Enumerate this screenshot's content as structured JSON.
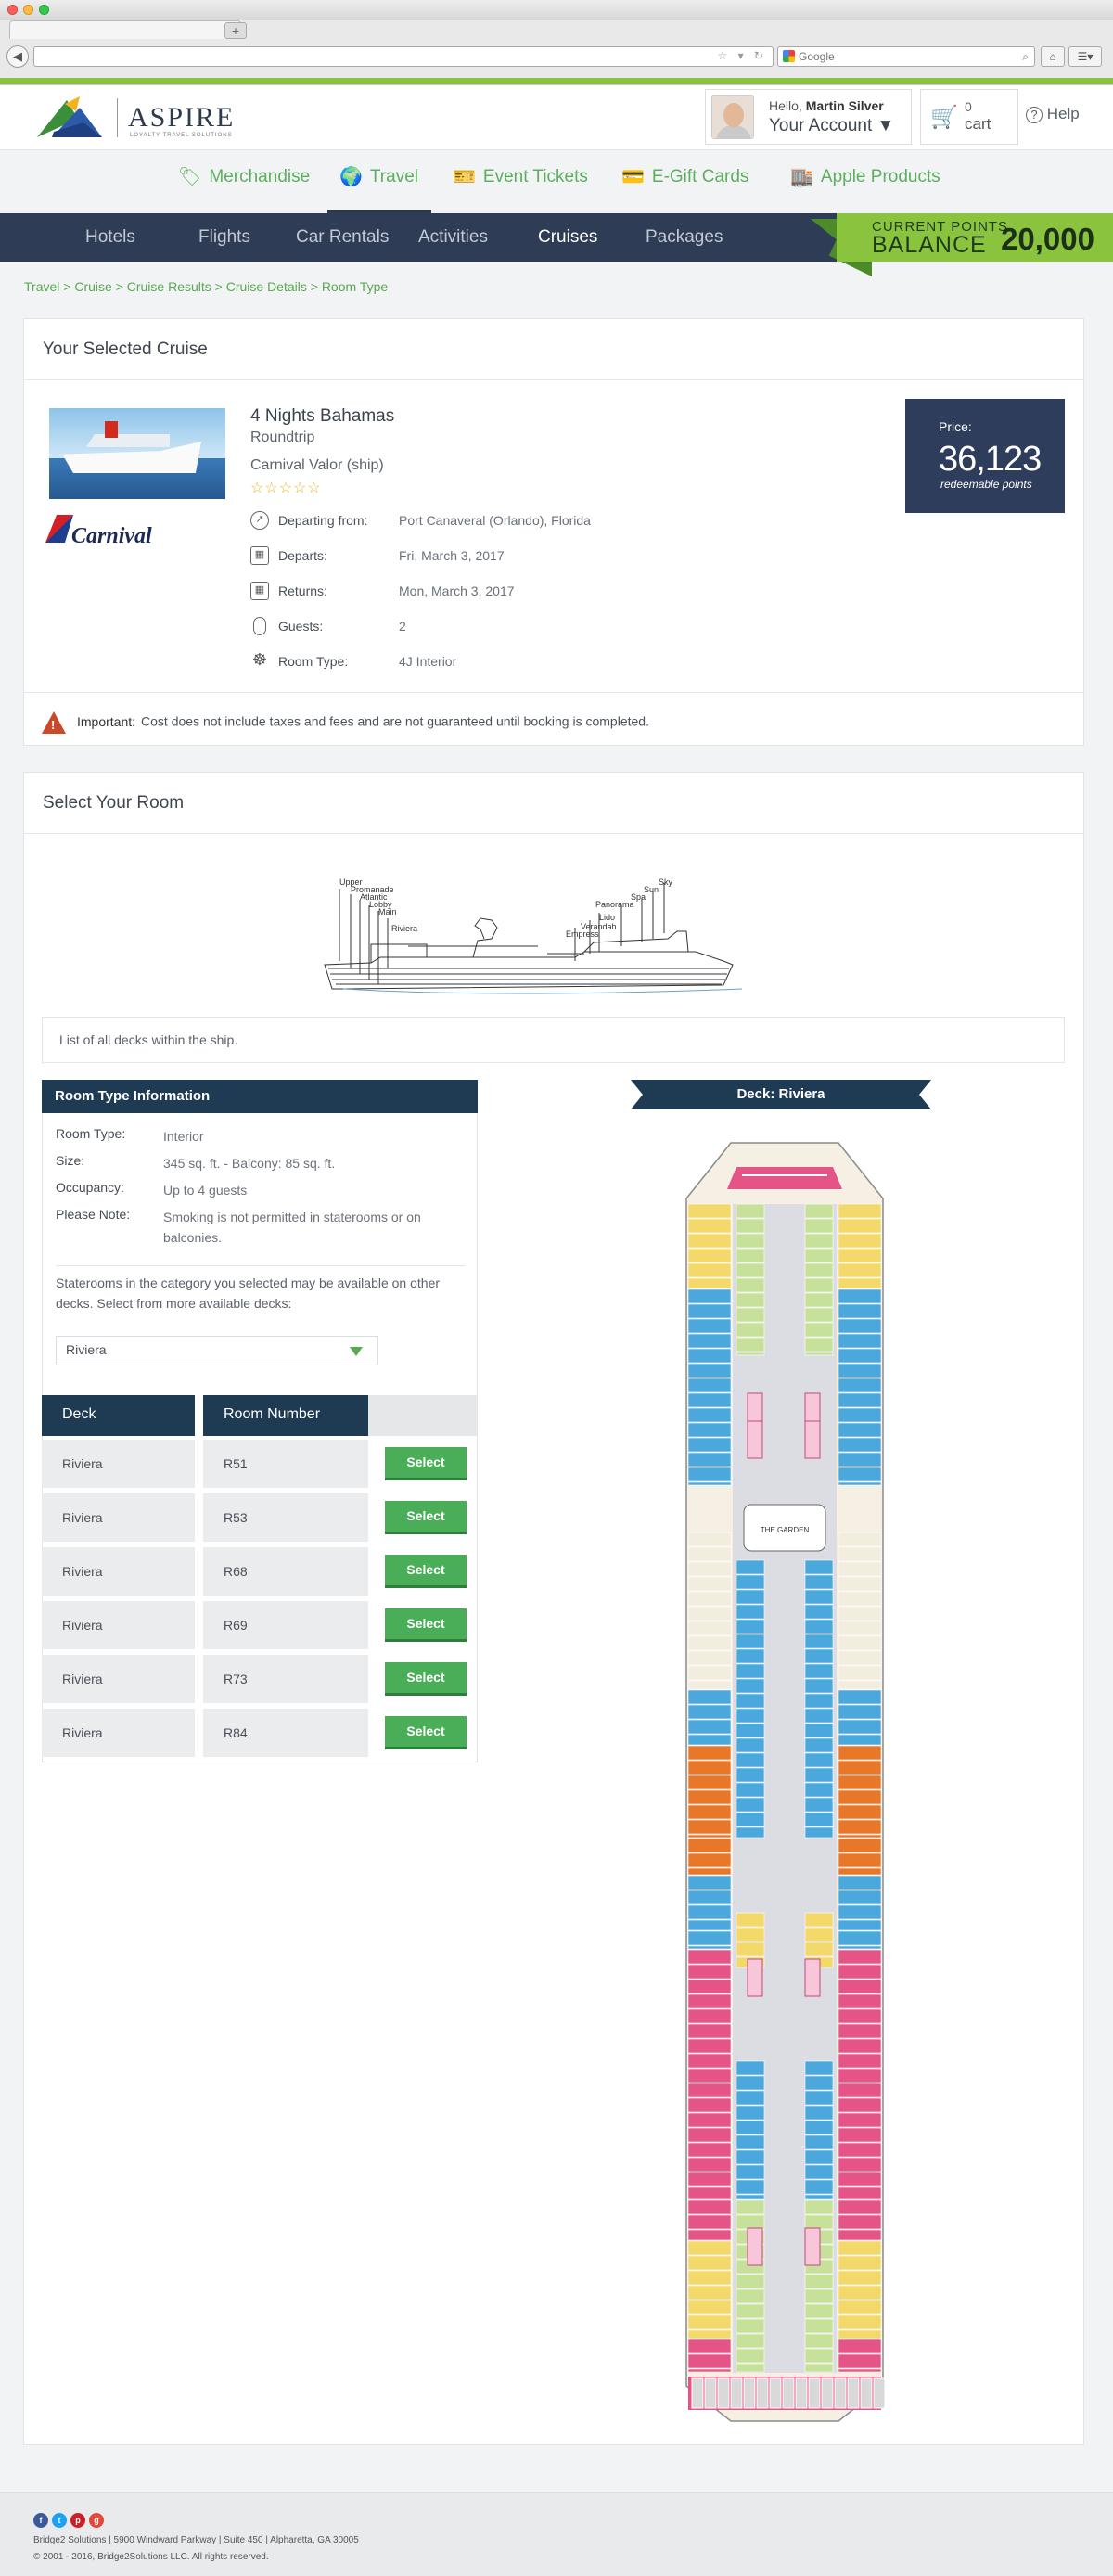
{
  "browser": {
    "search_placeholder": "Google",
    "new_tab": "+"
  },
  "header": {
    "logo_word": "ASPIRE",
    "logo_sub": "LOYALTY TRAVEL SOLUTIONS",
    "hello": "Hello,",
    "user": "Martin Silver",
    "account": "Your Account ▼",
    "cart_count": "0",
    "cart_label": "cart",
    "help": "Help"
  },
  "categories": [
    "Merchandise",
    "Travel",
    "Event Tickets",
    "E-Gift Cards",
    "Apple Products"
  ],
  "subnav": [
    "Hotels",
    "Flights",
    "Car Rentals",
    "Activities",
    "Cruises",
    "Packages"
  ],
  "points": {
    "label1": "CURRENT POINTS",
    "label2": "BALANCE",
    "value": "20,000"
  },
  "breadcrumb": "Travel > Cruise > Cruise Results > Cruise Details > Room Type",
  "cruise": {
    "section_title": "Your Selected Cruise",
    "title": "4 Nights Bahamas",
    "trip": "Roundtrip",
    "ship": "Carnival Valor (ship)",
    "stars": "☆☆☆☆☆",
    "brand": "Carnival",
    "details": [
      {
        "label": "Departing from:",
        "value": "Port Canaveral (Orlando), Florida"
      },
      {
        "label": "Departs:",
        "value": "Fri, March 3, 2017"
      },
      {
        "label": "Returns:",
        "value": "Mon, March 3, 2017"
      },
      {
        "label": "Guests:",
        "value": "2"
      },
      {
        "label": "Room Type:",
        "value": "4J Interior"
      }
    ],
    "price_label": "Price:",
    "price_value": "36,123",
    "price_unit": "redeemable points",
    "important_label": "Important:",
    "important_text": "Cost does not include taxes and fees and are not guaranteed until booking is completed."
  },
  "select_room": {
    "title": "Select Your Room",
    "deck_labels": [
      "Upper",
      "Promanade",
      "Atlantic",
      "Lobby",
      "Main",
      "Riviera",
      "Empress",
      "Verandah",
      "Lido",
      "Panorama",
      "Spa",
      "Sun",
      "Sky"
    ],
    "deck_list_text": "List of all decks within the ship.",
    "info_title": "Room Type Information",
    "info": [
      {
        "label": "Room Type:",
        "value": "Interior"
      },
      {
        "label": "Size:",
        "value": "345 sq. ft. - Balcony: 85 sq. ft."
      },
      {
        "label": "Occupancy:",
        "value": "Up to 4 guests"
      },
      {
        "label": "Please Note:",
        "value": "Smoking is not permitted in staterooms or on balconies."
      }
    ],
    "note": "Staterooms in the category you selected may be available on other decks. Select from more available decks:",
    "selected_deck": "Riviera",
    "table_headers": [
      "Deck",
      "Room Number"
    ],
    "rows": [
      {
        "deck": "Riviera",
        "room": "R51"
      },
      {
        "deck": "Riviera",
        "room": "R53"
      },
      {
        "deck": "Riviera",
        "room": "R68"
      },
      {
        "deck": "Riviera",
        "room": "R69"
      },
      {
        "deck": "Riviera",
        "room": "R73"
      },
      {
        "deck": "Riviera",
        "room": "R84"
      }
    ],
    "select_label": "Select",
    "deck_banner": "Deck: Riviera",
    "garden_label": "THE GARDEN"
  },
  "footer": {
    "address": "Bridge2 Solutions | 5900 Windward Parkway | Suite 450 | Alpharetta, GA 30005",
    "copyright": "© 2001 - 2016, Bridge2Solutions LLC. All rights reserved."
  },
  "colors": {
    "green": "#8ac43f",
    "navy": "#2f3c55",
    "deck_orange": "#e8772a",
    "deck_blue": "#4aa8dc",
    "deck_yellow": "#f3d86a",
    "deck_pink": "#e45487",
    "deck_lightgreen": "#c8e19a"
  }
}
